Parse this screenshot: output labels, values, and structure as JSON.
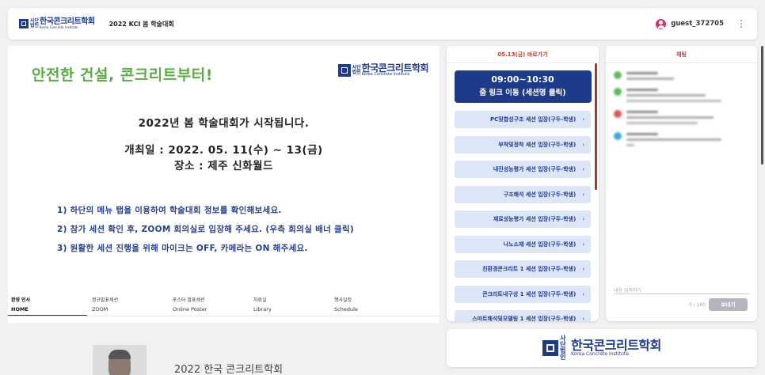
{
  "header": {
    "logo_ko": "한국콘크리트학회",
    "logo_en": "Korea Concrete Institute",
    "logo_small": "사단법인",
    "event_title": "2022 KCI 봄 학술대회",
    "username": "guest_372705",
    "menu_icon": "kebab-menu-icon"
  },
  "banner": {
    "slogan": "안전한 건설, 콘크리트부터!",
    "headline": "2022년 봄 학술대회가 시작됩니다.",
    "date_line": "개최일 : 2022. 05. 11(수) ~ 13(금)",
    "venue_line": "장소 : 제주 신화월드",
    "notes": [
      "1) 하단의 메뉴 탭을 이용하여 학술대회 정보를 확인해보세요.",
      "2) 참가 세션 확인 후, ZOOM 회의실로 입장해 주세요. (우측 회의실 배너 클릭)",
      "3) 원활한 세션 진행을 위해 마이크는 OFF, 카메라는 ON 해주세요."
    ]
  },
  "tabs": [
    {
      "ko": "환영 인사",
      "en": "HOME",
      "active": true
    },
    {
      "ko": "정규발표세션",
      "en": "ZOOM",
      "active": false
    },
    {
      "ko": "포스터 발표세션",
      "en": "Online Poster",
      "active": false
    },
    {
      "ko": "자료실",
      "en": "Library",
      "active": false
    },
    {
      "ko": "행사일정",
      "en": "Schedule",
      "active": false
    }
  ],
  "greeting": {
    "title": "2022 한국 콘크리트학회"
  },
  "shortcut": {
    "title": "05.13(금) 바로가기",
    "zoom_time": "09:00~10:30",
    "zoom_label": "줌 링크 이동 (세션명 클릭)",
    "sessions": [
      "PC및합성구조 세션 입장(구두-학생)",
      "부착및정착 세션 입장(구두-학생)",
      "내진성능평가 세션 입장(구두-학생)",
      "구조해석 세션 입장(구두-학생)",
      "재료성능평가 세션 입장(구두-학생)",
      "나노소재 세션 입장(구두-학생)",
      "친환경콘크리트 1 세션 입장(구두-학생)",
      "콘크리트내구성 1 세션 입장(구두-학생)",
      "스마트해석및모델링 1 세션 입장(구두-학생)"
    ]
  },
  "chat": {
    "title": "채팅",
    "input_placeholder": "내용 입력하기",
    "count": "0 / 180",
    "send_label": "보내기",
    "message_colors": [
      "#5cb85c",
      "#5cb85c",
      "#e05555",
      "#3ea6d8"
    ]
  }
}
